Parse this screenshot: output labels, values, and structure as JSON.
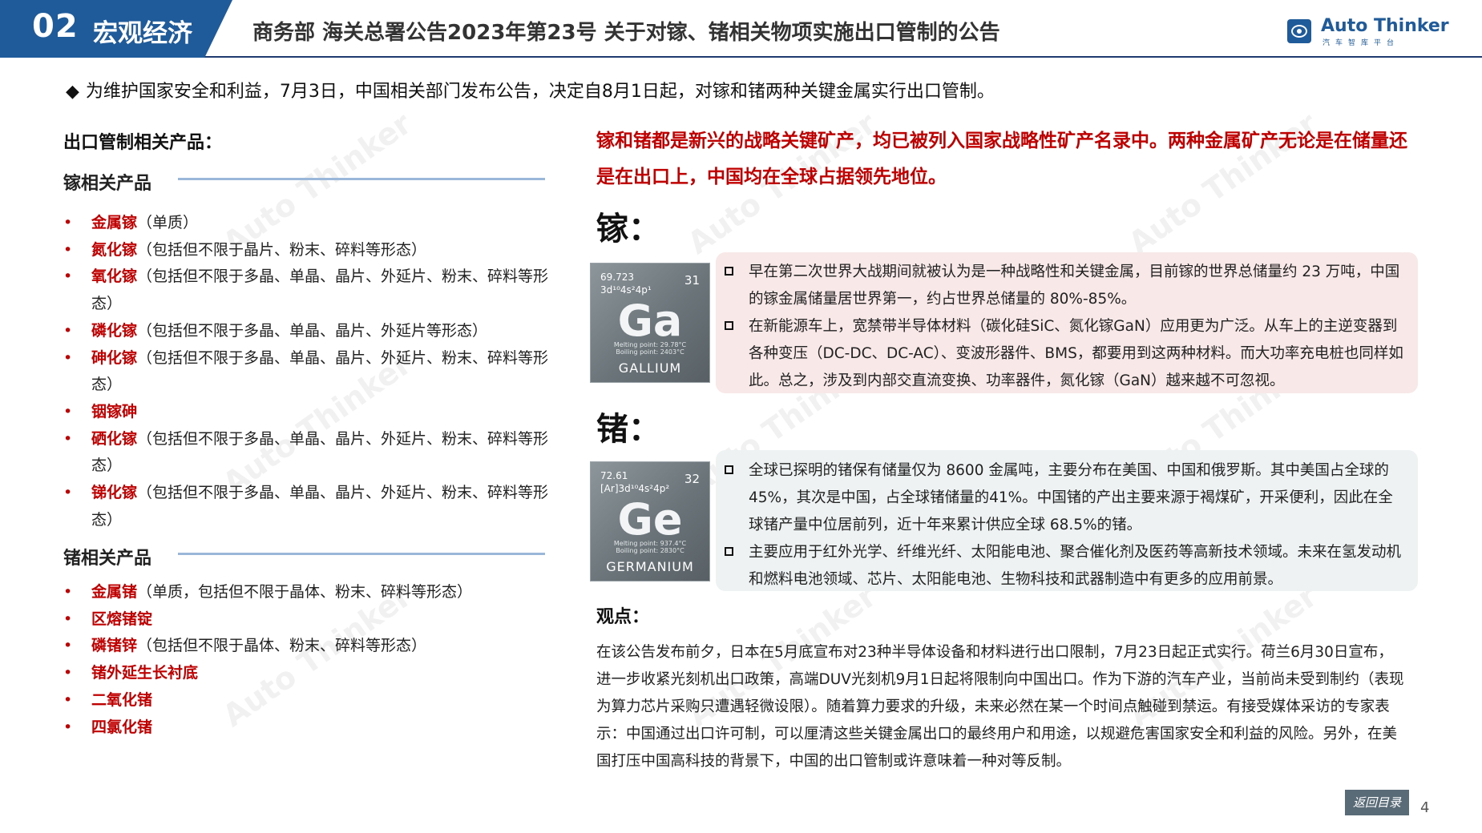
{
  "header": {
    "section_number": "02",
    "section_name": "宏观经济",
    "title": "商务部 海关总署公告2023年第23号 关于对镓、锗相关物项实施出口管制的公告",
    "logo_name": "Auto Thinker",
    "logo_sub": "汽车智库平台"
  },
  "intro": {
    "marker": "◆",
    "text": "为维护国家安全和利益，7月3日，中国相关部门发布公告，决定自8月1日起，对镓和锗两种关键金属实行出口管制。"
  },
  "left": {
    "heading": "出口管制相关产品：",
    "ga_group": {
      "title": "镓相关产品",
      "items": [
        {
          "name": "金属镓",
          "desc": "（单质）"
        },
        {
          "name": "氮化镓",
          "desc": "（包括但不限于晶片、粉末、碎料等形态）"
        },
        {
          "name": "氧化镓",
          "desc": "（包括但不限于多晶、单晶、晶片、外延片、粉末、碎料等形态）"
        },
        {
          "name": "磷化镓",
          "desc": "（包括但不限于多晶、单晶、晶片、外延片等形态）"
        },
        {
          "name": "砷化镓",
          "desc": "（包括但不限于多晶、单晶、晶片、外延片、粉末、碎料等形态）"
        },
        {
          "name": "铟镓砷",
          "desc": ""
        },
        {
          "name": "硒化镓",
          "desc": "（包括但不限于多晶、单晶、晶片、外延片、粉末、碎料等形态）"
        },
        {
          "name": "锑化镓",
          "desc": "（包括但不限于多晶、单晶、晶片、外延片、粉末、碎料等形态）"
        }
      ]
    },
    "ge_group": {
      "title": "锗相关产品",
      "items": [
        {
          "name": "金属锗",
          "desc": "（单质，包括但不限于晶体、粉末、碎料等形态）"
        },
        {
          "name": "区熔锗锭",
          "desc": ""
        },
        {
          "name": "磷锗锌",
          "desc": "（包括但不限于晶体、粉末、碎料等形态）"
        },
        {
          "name": "锗外延生长衬底",
          "desc": ""
        },
        {
          "name": "二氧化锗",
          "desc": ""
        },
        {
          "name": "四氯化锗",
          "desc": ""
        }
      ]
    },
    "bullet": "•"
  },
  "right": {
    "red_note": "镓和锗都是新兴的战略关键矿产，均已被列入国家战略性矿产名录中。两种金属矿产无论是在储量还是在出口上，中国均在全球占据领先地位。",
    "ga": {
      "heading": "镓：",
      "tile": {
        "mass": "69.723",
        "config": "3d¹⁰4s²4p¹",
        "number": "31",
        "symbol": "Ga",
        "melting": "Melting point: 29.78°C",
        "boiling": "Boiling point: 2403°C",
        "name": "GALLIUM"
      },
      "points": [
        "早在第二次世界大战期间就被认为是一种战略性和关键金属，目前镓的世界总储量约 23 万吨，中国的镓金属储量居世界第一，约占世界总储量的 80%-85%。",
        "在新能源车上，宽禁带半导体材料（碳化硅SiC、氮化镓GaN）应用更为广泛。从车上的主逆变器到各种变压（DC-DC、DC-AC）、变波形器件、BMS，都要用到这两种材料。而大功率充电桩也同样如此。总之，涉及到内部交直流变换、功率器件，氮化镓（GaN）越来越不可忽视。"
      ]
    },
    "ge": {
      "heading": "锗：",
      "tile": {
        "mass": "72.61",
        "config": "[Ar]3d¹⁰4s²4p²",
        "number": "32",
        "symbol": "Ge",
        "melting": "Melting point: 937.4°C",
        "boiling": "Boiling point: 2830°C",
        "name": "GERMANIUM"
      },
      "points": [
        "全球已探明的锗保有储量仅为 8600 金属吨，主要分布在美国、中国和俄罗斯。其中美国占全球的45%，其次是中国，占全球锗储量的41%。中国锗的产出主要来源于褐煤矿，开采便利，因此在全球锗产量中位居前列，近十年来累计供应全球 68.5%的锗。",
        "主要应用于红外光学、纤维光纤、太阳能电池、聚合催化剂及医药等高新技术领域。未来在氢发动机和燃料电池领域、芯片、太阳能电池、生物科技和武器制造中有更多的应用前景。"
      ]
    },
    "view": {
      "heading": "观点：",
      "body": "在该公告发布前夕，日本在5月底宣布对23种半导体设备和材料进行出口限制，7月23日起正式实行。荷兰6月30日宣布，进一步收紧光刻机出口政策，高端DUV光刻机9月1日起将限制向中国出口。作为下游的汽车产业，当前尚未受到制约（表现为算力芯片采购只遭遇轻微设限）。随着算力要求的升级，未来必然在某一个时间点触碰到禁运。有接受媒体采访的专家表示：中国通过出口许可制，可以厘清这些关键金属出口的最终用户和用途，以规避危害国家安全和利益的风险。另外，在美国打压中国高科技的背景下，中国的出口管制或许意味着一种对等反制。"
    }
  },
  "footer": {
    "back_label": "返回目录",
    "page_number": "4"
  },
  "watermark": "Auto Thinker",
  "colors": {
    "brand": "#1f5b9a",
    "accent_red": "#c00000",
    "ga_card": "#f8e8e8",
    "ge_card": "#eef2f3"
  }
}
